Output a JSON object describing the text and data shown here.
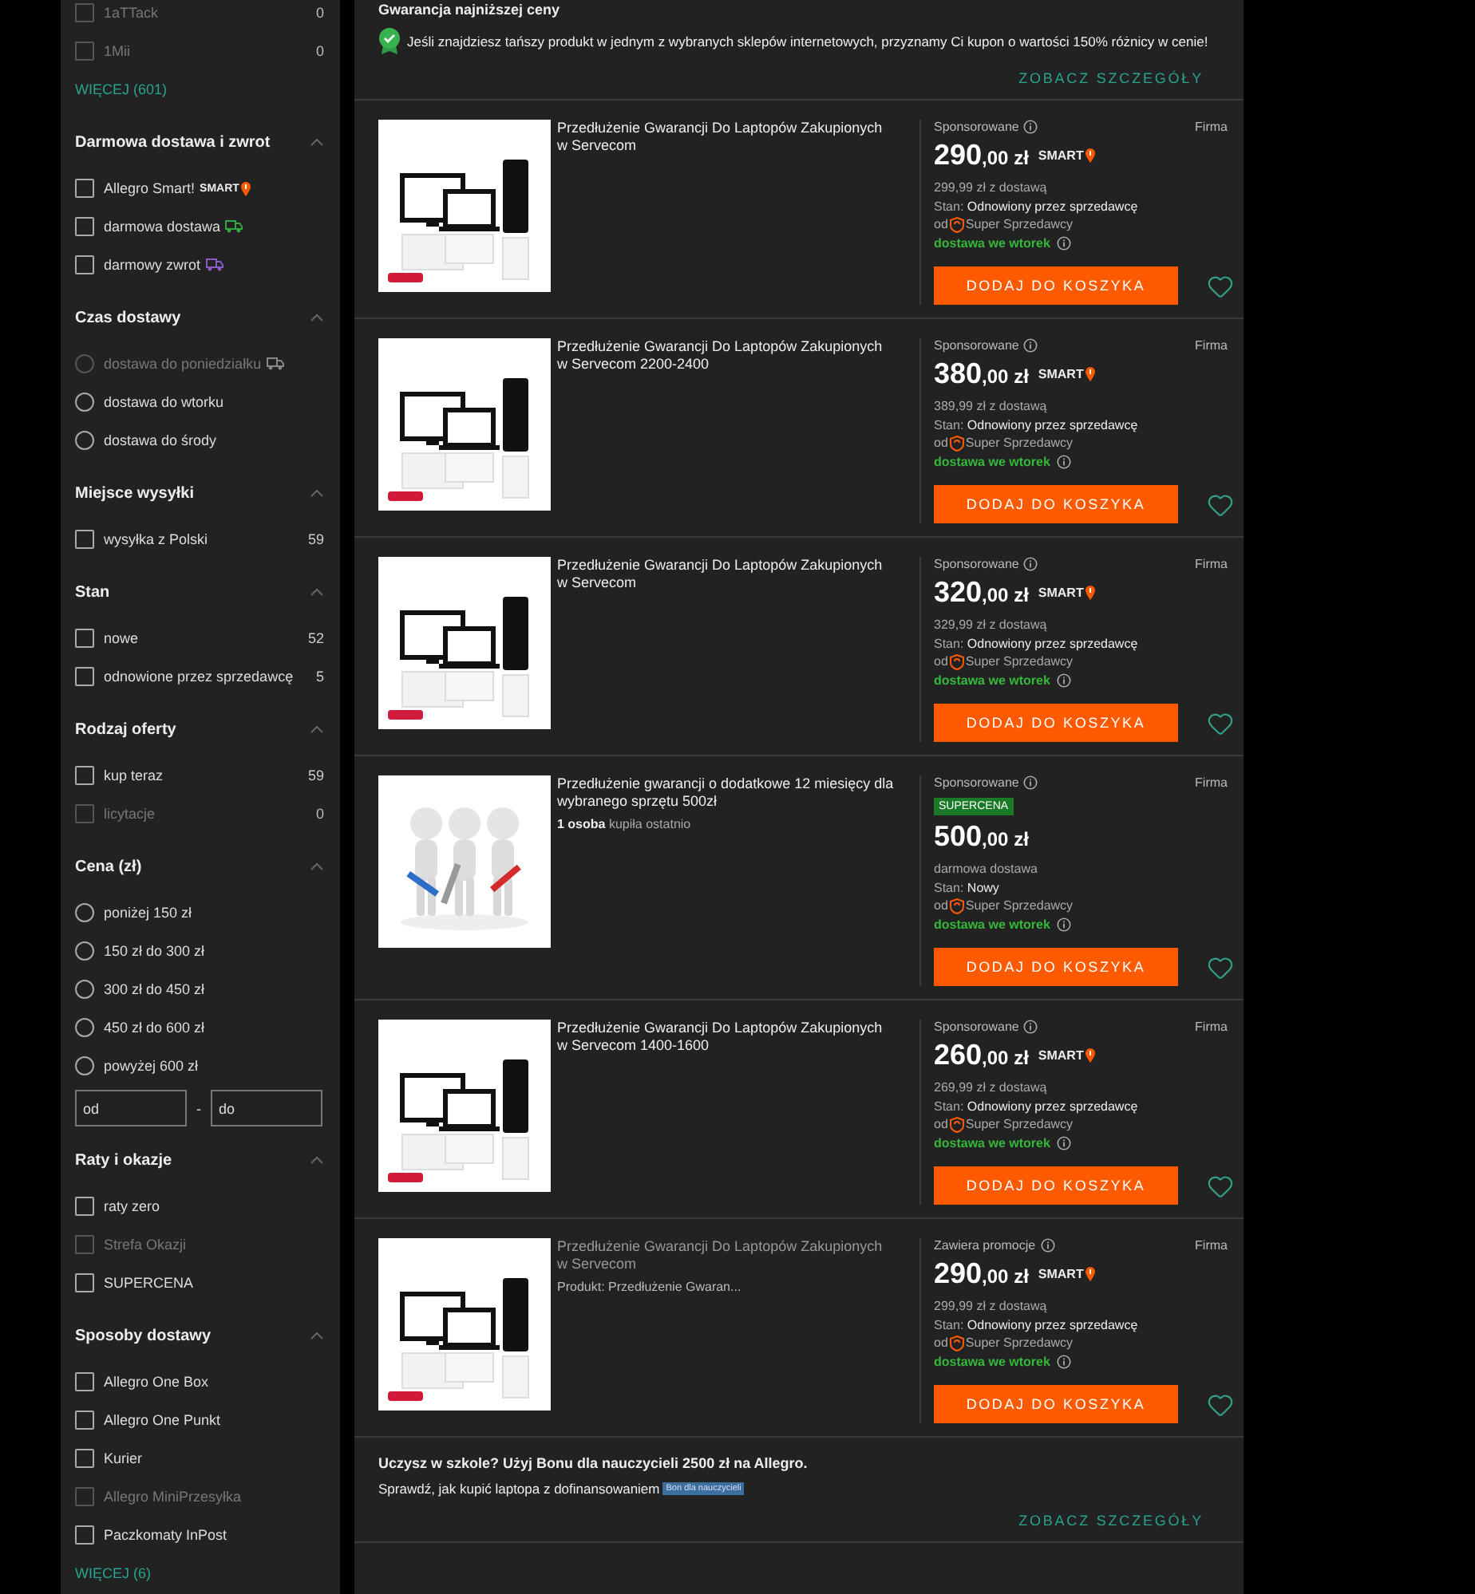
{
  "sidebar": {
    "sections": [
      {
        "items": [
          {
            "kind": "checkbox",
            "label": "1aTTack",
            "count": "0",
            "disabled": true,
            "checked": false
          },
          {
            "kind": "checkbox",
            "label": "1Mii",
            "count": "0",
            "disabled": true,
            "checked": false
          }
        ],
        "more": "WIĘCEJ (601)"
      },
      {
        "title": "Darmowa dostawa i zwrot",
        "expanded": true,
        "items": [
          {
            "kind": "checkbox",
            "label": "Allegro Smart!",
            "badge": "SMART",
            "disabled": false,
            "checked": false
          },
          {
            "kind": "checkbox",
            "label": "darmowa dostawa",
            "suffix": {
              "kind": "delivery"
            },
            "disabled": false,
            "checked": false
          },
          {
            "kind": "checkbox",
            "label": "darmowy zwrot",
            "suffix": {
              "kind": "return"
            },
            "disabled": false,
            "checked": false
          }
        ]
      },
      {
        "title": "Czas dostawy",
        "expanded": true,
        "items": [
          {
            "kind": "radio",
            "label": "dostawa do poniedziałku",
            "suffix": {
              "kind": "scheduled"
            },
            "disabled": true,
            "selected": false
          },
          {
            "kind": "radio",
            "label": "dostawa do wtorku",
            "disabled": false,
            "selected": false
          },
          {
            "kind": "radio",
            "label": "dostawa do środy",
            "disabled": false,
            "selected": false
          }
        ]
      },
      {
        "title": "Miejsce wysyłki",
        "expanded": true,
        "items": [
          {
            "kind": "checkbox",
            "label": "wysyłka z Polski",
            "count": "59",
            "disabled": false,
            "checked": false
          }
        ]
      },
      {
        "title": "Stan",
        "expanded": true,
        "items": [
          {
            "kind": "checkbox",
            "label": "nowe",
            "count": "52",
            "disabled": false,
            "checked": false
          },
          {
            "kind": "checkbox",
            "label": "odnowione przez sprzedawcę",
            "count": "5",
            "disabled": false,
            "checked": false
          }
        ]
      },
      {
        "title": "Rodzaj oferty",
        "expanded": true,
        "items": [
          {
            "kind": "checkbox",
            "label": "kup teraz",
            "count": "59",
            "disabled": false,
            "checked": false
          },
          {
            "kind": "checkbox",
            "label": "licytacje",
            "count": "0",
            "disabled": true,
            "checked": false
          }
        ]
      },
      {
        "title": "Cena (zł)",
        "expanded": true,
        "items": [
          {
            "kind": "radio",
            "label": "poniżej 150 zł",
            "disabled": false,
            "selected": false
          },
          {
            "kind": "radio",
            "label": "150 zł do 300 zł",
            "disabled": false,
            "selected": false
          },
          {
            "kind": "radio",
            "label": "300 zł do 450 zł",
            "disabled": false,
            "selected": false
          },
          {
            "kind": "radio",
            "label": "450 zł do 600 zł",
            "disabled": false,
            "selected": false
          },
          {
            "kind": "radio",
            "label": "powyżej 600 zł",
            "disabled": false,
            "selected": false
          }
        ],
        "range": {
          "from_placeholder": "od",
          "separator": "-",
          "to_placeholder": "do"
        }
      },
      {
        "title": "Raty i okazje",
        "expanded": true,
        "items": [
          {
            "kind": "checkbox",
            "label": "raty zero",
            "disabled": false,
            "checked": false
          },
          {
            "kind": "checkbox",
            "label": "Strefa Okazji",
            "disabled": true,
            "checked": false
          },
          {
            "kind": "checkbox",
            "label": "SUPERCENA",
            "disabled": false,
            "checked": false
          }
        ]
      },
      {
        "title": "Sposoby dostawy",
        "expanded": true,
        "items": [
          {
            "kind": "checkbox",
            "label": "Allegro One Box",
            "disabled": false,
            "checked": false
          },
          {
            "kind": "checkbox",
            "label": "Allegro One Punkt",
            "disabled": false,
            "checked": false
          },
          {
            "kind": "checkbox",
            "label": "Kurier",
            "disabled": false,
            "checked": false
          },
          {
            "kind": "checkbox",
            "label": "Allegro MiniPrzesyłka",
            "disabled": true,
            "checked": false
          },
          {
            "kind": "checkbox",
            "label": "Paczkomaty InPost",
            "disabled": false,
            "checked": false
          }
        ],
        "more": "WIĘCEJ (6)"
      }
    ]
  },
  "top_banner": {
    "title": "Gwarancja najniższej ceny",
    "text": "Jeśli znajdziesz tańszy produkt w jednym z wybranych sklepów internetowych, przyznamy Ci kupon o wartości 150% różnicy w cenie!",
    "link": "ZOBACZ SZCZEGÓŁY"
  },
  "products": [
    {
      "title": "Przedłużenie Gwarancji Do Laptopów Zakupionych w Servecom",
      "visited": false,
      "label": "Sponsorowane",
      "seller_type": "Firma",
      "price_main": "290",
      "price_fraction": ",00 zł",
      "smart": "SMART",
      "with_delivery": "299,99 zł z dostawą",
      "condition_label": "Stan:",
      "condition": "Odnowiony przez sprzedawcę",
      "seller_prefix": "od",
      "seller": "Super Sprzedawcy",
      "delivery": "dostawa we wtorek",
      "button": "DODAJ DO KOSZYKA"
    },
    {
      "title": "Przedłużenie Gwarancji Do Laptopów Zakupionych w Servecom 2200-2400",
      "visited": false,
      "label": "Sponsorowane",
      "seller_type": "Firma",
      "price_main": "380",
      "price_fraction": ",00 zł",
      "smart": "SMART",
      "with_delivery": "389,99 zł z dostawą",
      "condition_label": "Stan:",
      "condition": "Odnowiony przez sprzedawcę",
      "seller_prefix": "od",
      "seller": "Super Sprzedawcy",
      "delivery": "dostawa we wtorek",
      "button": "DODAJ DO KOSZYKA"
    },
    {
      "title": "Przedłużenie Gwarancji Do Laptopów Zakupionych w Servecom",
      "visited": false,
      "label": "Sponsorowane",
      "seller_type": "Firma",
      "price_main": "320",
      "price_fraction": ",00 zł",
      "smart": "SMART",
      "with_delivery": "329,99 zł z dostawą",
      "condition_label": "Stan:",
      "condition": "Odnowiony przez sprzedawcę",
      "seller_prefix": "od",
      "seller": "Super Sprzedawcy",
      "delivery": "dostawa we wtorek",
      "button": "DODAJ DO KOSZYKA"
    },
    {
      "title": "Przedłużenie gwarancji o dodatkowe 12 miesięcy dla wybranego sprzętu 500zł",
      "visited": false,
      "buyers": "1 osoba",
      "buyers_text": "kupiła ostatnio",
      "label": "Sponsorowane",
      "seller_type": "Firma",
      "promo_badge": "SUPERCENA",
      "price_main": "500",
      "price_fraction": ",00 zł",
      "with_delivery": "darmowa dostawa",
      "condition_label": "Stan:",
      "condition": "Nowy",
      "seller_prefix": "od",
      "seller": "Super Sprzedawcy",
      "delivery": "dostawa we wtorek",
      "button": "DODAJ DO KOSZYKA"
    },
    {
      "title": "Przedłużenie Gwarancji Do Laptopów Zakupionych w Servecom 1400-1600",
      "visited": false,
      "label": "Sponsorowane",
      "seller_type": "Firma",
      "price_main": "260",
      "price_fraction": ",00 zł",
      "smart": "SMART",
      "with_delivery": "269,99 zł z dostawą",
      "condition_label": "Stan:",
      "condition": "Odnowiony przez sprzedawcę",
      "seller_prefix": "od",
      "seller": "Super Sprzedawcy",
      "delivery": "dostawa we wtorek",
      "button": "DODAJ DO KOSZYKA"
    },
    {
      "title": "Przedłużenie Gwarancji Do Laptopów Zakupionych w Servecom",
      "visited": true,
      "subtitle": "Produkt: Przedłużenie Gwaran...",
      "label": "Zawiera promocje",
      "seller_type": "Firma",
      "price_main": "290",
      "price_fraction": ",00 zł",
      "smart": "SMART",
      "with_delivery": "299,99 zł z dostawą",
      "condition_label": "Stan:",
      "condition": "Odnowiony przez sprzedawcę",
      "seller_prefix": "od",
      "seller": "Super Sprzedawcy",
      "delivery": "dostawa we wtorek",
      "button": "DODAJ DO KOSZYKA"
    }
  ],
  "bottom_banner": {
    "title": "Uczysz w szkole? Użyj Bonu dla nauczycieli 2500 zł na Allegro.",
    "text": "Sprawdź, jak kupić laptopa z dofinansowaniem",
    "tag": "Bon dla nauczycieli",
    "link": "ZOBACZ SZCZEGÓŁY"
  }
}
